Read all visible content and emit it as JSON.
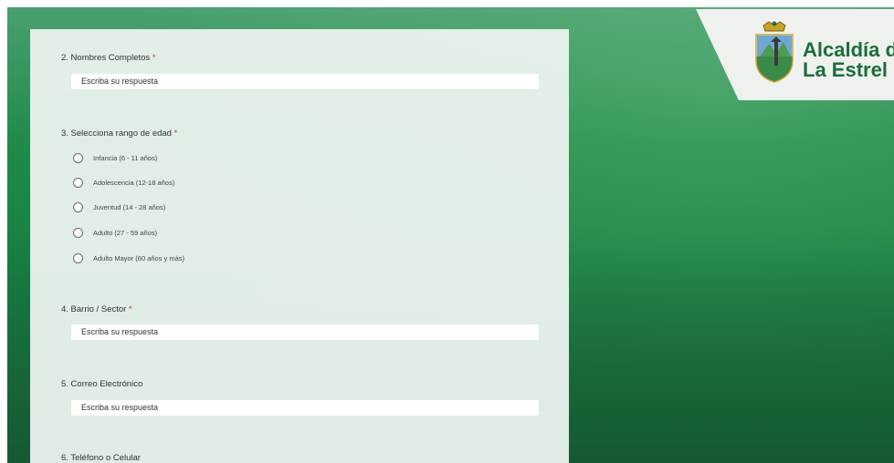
{
  "brand": {
    "line1": "Alcaldía d",
    "line2": "La Estrel"
  },
  "colors": {
    "accent_green": "#1b6e3b",
    "required_star": "#d0342c",
    "panel_bg": "#e8f3ec"
  },
  "form": {
    "q2": {
      "label": "2. Nombres Completos",
      "required": "*",
      "placeholder": "Escriba su respuesta"
    },
    "q3": {
      "label": "3. Selecciona rango de edad",
      "required": "*",
      "options": [
        "Infancia (6 - 11 años)",
        "Adolescencia (12-18 años)",
        "Juventud (14 - 28 años)",
        "Adulto (27 - 59 años)",
        "Adulto Mayor (60 años y más)"
      ]
    },
    "q4": {
      "label": "4. Barrio / Sector",
      "required": "*",
      "placeholder": "Escriba su respuesta"
    },
    "q5": {
      "label": "5. Correo Electrónico",
      "placeholder": "Escriba su respuesta"
    },
    "q6": {
      "label": "6. Teléfono o Celular"
    }
  }
}
